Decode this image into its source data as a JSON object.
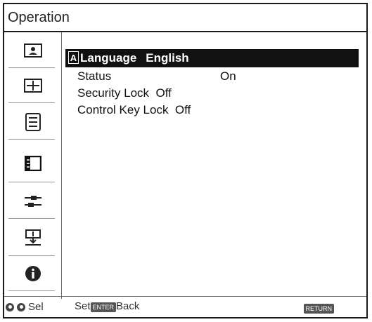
{
  "window": {
    "title": "Operation"
  },
  "sidebar": {
    "items": [
      {
        "icon": "picture-icon"
      },
      {
        "icon": "screen-icon"
      },
      {
        "icon": "setup-icon"
      },
      {
        "icon": "function-icon"
      },
      {
        "icon": "connection-icon"
      },
      {
        "icon": "installation-icon"
      },
      {
        "icon": "information-icon"
      }
    ],
    "selected_index": 3
  },
  "menu": {
    "items": [
      {
        "label": "Language",
        "value": "English",
        "selected": true
      },
      {
        "label": "Status",
        "value": "On"
      },
      {
        "label": "Security Lock",
        "value": "Off"
      },
      {
        "label": "Control Key Lock",
        "value": "Off"
      }
    ]
  },
  "footer": {
    "select_text": "Sel",
    "set_text": "Set",
    "back_text": "Back",
    "enter_key": "ENTER",
    "return_key": "RETURN"
  },
  "colors": {
    "selection_bg": "#111111",
    "frame": "#1a1a1a"
  }
}
